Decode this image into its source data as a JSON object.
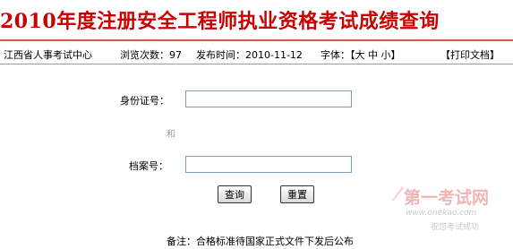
{
  "header": {
    "title": "2010年度注册安全工程师执业资格考试成绩查询"
  },
  "info_bar": {
    "source": "江西省人事考试中心",
    "views": "浏览次数：97",
    "published": "发布时间：2010-11-12",
    "font_size": "字体：【大 中 小】",
    "print": "【打印文档】"
  },
  "form": {
    "id_label": "身份证号：",
    "id_value": "",
    "and_label": "和",
    "archive_label": "档案号：",
    "archive_value": "",
    "query_button": "查询",
    "reset_button": "重置"
  },
  "footer": {
    "note": "备注：合格标准待国家正式文件下发后公布"
  },
  "watermark": {
    "title": "第一考试网",
    "url": "www.onekao.com",
    "slogan": "祝您考试成功"
  },
  "colors": {
    "title": "#cc0000",
    "rule": "#d9534f",
    "input_border": "#7f9db9"
  }
}
